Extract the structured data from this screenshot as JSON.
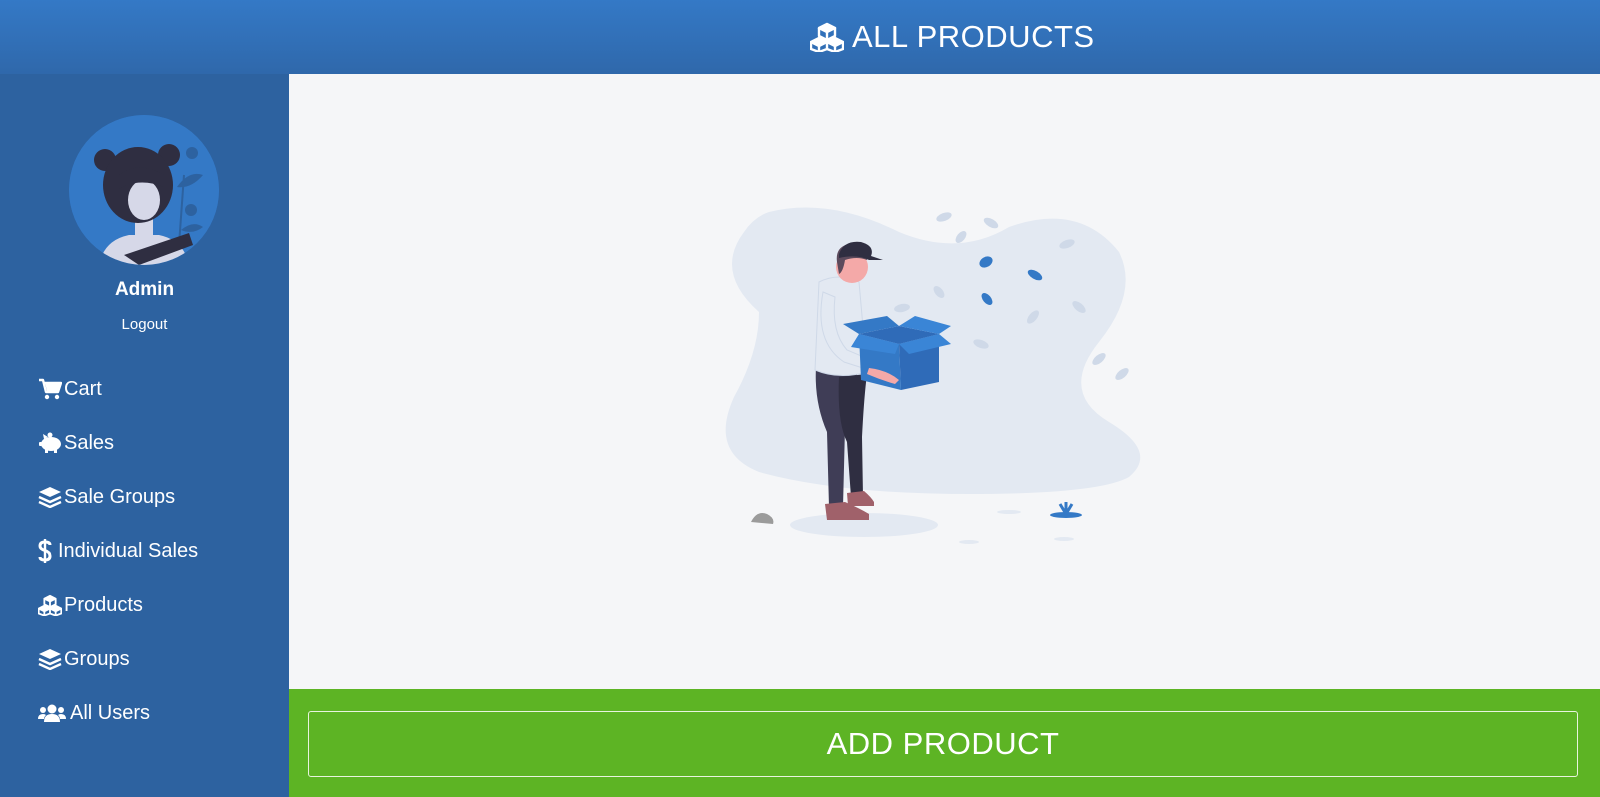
{
  "header": {
    "title": "ALL PRODUCTS",
    "icon": "cubes-icon"
  },
  "sidebar": {
    "user_name": "Admin",
    "logout_label": "Logout",
    "avatar_icon": "woman-avatar-illustration",
    "items": [
      {
        "label": "Cart",
        "icon": "shopping-cart-icon"
      },
      {
        "label": "Sales",
        "icon": "piggy-bank-icon"
      },
      {
        "label": "Sale Groups",
        "icon": "layer-group-icon"
      },
      {
        "label": "Individual Sales",
        "icon": "dollar-sign-icon"
      },
      {
        "label": "Products",
        "icon": "cubes-icon"
      },
      {
        "label": "Groups",
        "icon": "layer-group-icon"
      },
      {
        "label": "All Users",
        "icon": "users-icon"
      }
    ]
  },
  "main": {
    "illustration": "person-holding-box-illustration"
  },
  "footer": {
    "add_button_label": "ADD PRODUCT"
  },
  "colors": {
    "header": "#3479c6",
    "sidebar": "#2d62a0",
    "main_bg": "#f5f6f8",
    "footer": "#5db424",
    "accent_blue": "#3479c6"
  }
}
